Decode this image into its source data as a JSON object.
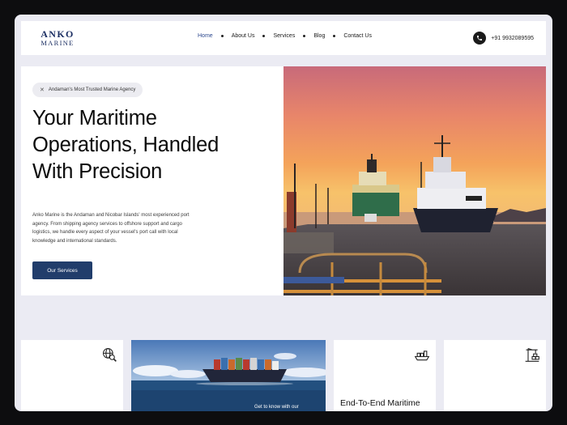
{
  "brand": {
    "line1": "ANKO",
    "line2": "MARINE"
  },
  "nav": {
    "items": [
      {
        "label": "Home",
        "active": true
      },
      {
        "label": "About Us"
      },
      {
        "label": "Services"
      },
      {
        "label": "Blog"
      },
      {
        "label": "Contact Us"
      }
    ],
    "phone": "+91 9932089595"
  },
  "hero": {
    "badge": "Andaman's Most Trusted Marine Agency",
    "title_lines": [
      "Your Maritime",
      "Operations, Handled",
      "With Precision"
    ],
    "description": "Anko Marine is the Andaman and Nicobar Islands' most experienced port agency. From shipping agency services to offshore support and cargo logistics, we handle every aspect of your vessel's port call with local knowledge and international standards.",
    "cta": "Our Services"
  },
  "cards": {
    "card1_icon": "globe-search-icon",
    "card2_caption": "Get to know with our",
    "card3_title": "End-To-End Maritime",
    "card3_icon": "cargo-ship-icon",
    "card4_icon": "port-crane-icon"
  },
  "colors": {
    "accent": "#213d6b",
    "brand": "#1c2f63",
    "background": "#ebebf3"
  }
}
